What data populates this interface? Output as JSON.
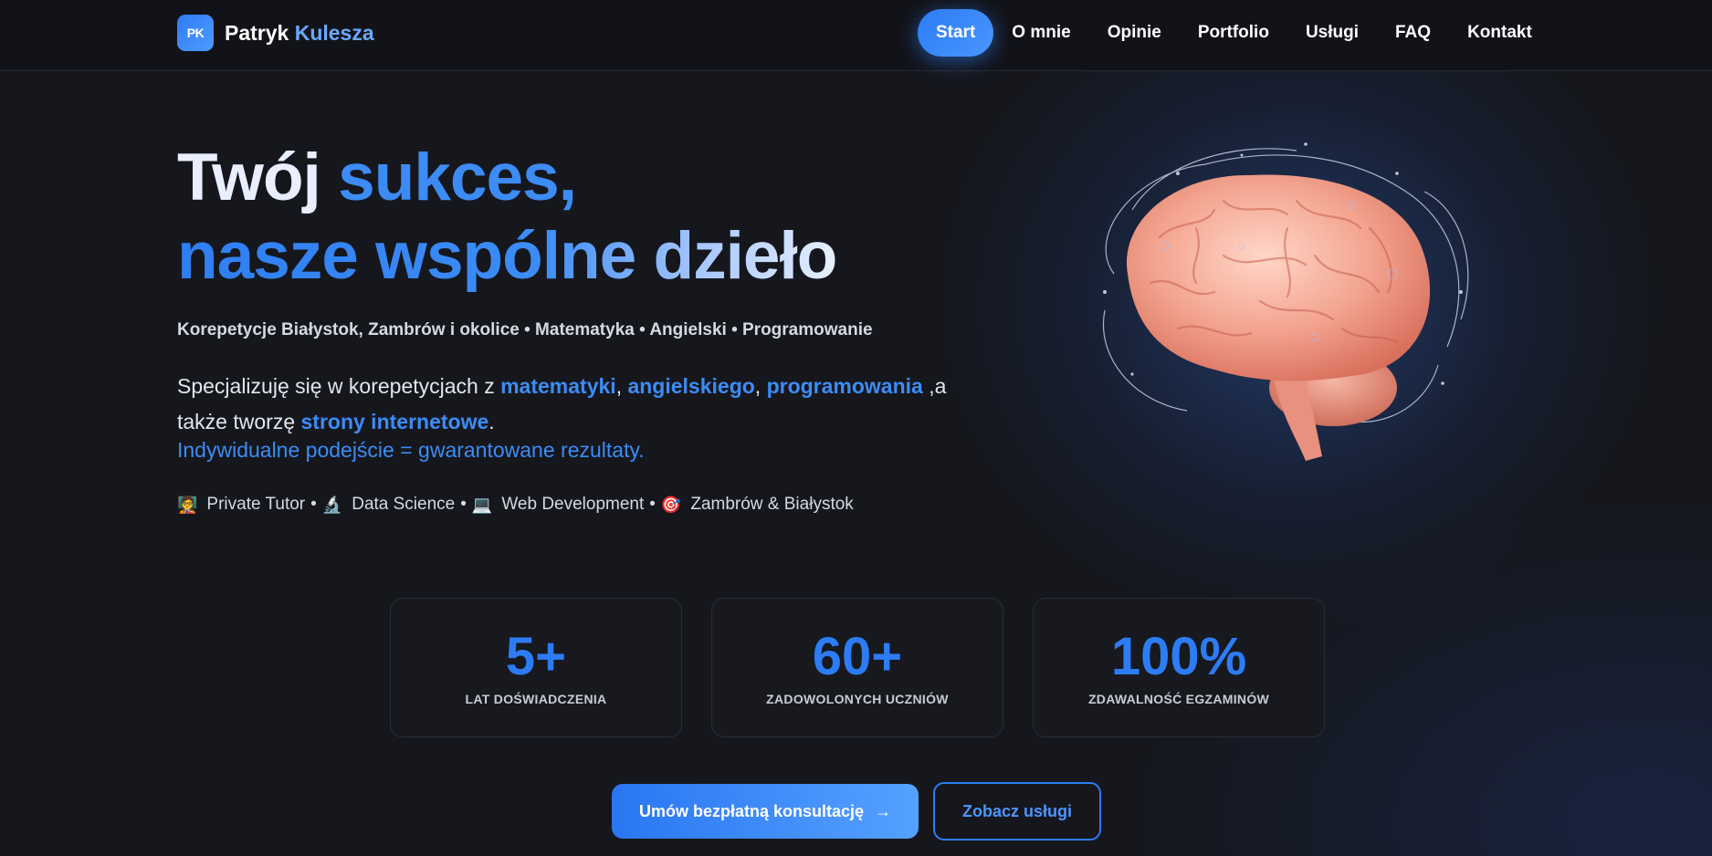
{
  "brand": {
    "badge": "PK",
    "first_name": "Patryk",
    "last_name": "Kulesza"
  },
  "nav": {
    "items": [
      {
        "label": "Start",
        "active": true
      },
      {
        "label": "O mnie"
      },
      {
        "label": "Opinie"
      },
      {
        "label": "Portfolio"
      },
      {
        "label": "Usługi"
      },
      {
        "label": "FAQ"
      },
      {
        "label": "Kontakt"
      }
    ]
  },
  "hero": {
    "title_line1_a": "Twój ",
    "title_line1_b": "sukces,",
    "title_line2": "nasze wspólne dzieło",
    "subtitle": "Korepetycje Białystok, Zambrów i okolice • Matematyka • Angielski • Programowanie",
    "desc": {
      "p1": "Specjalizuję się w korepetycjach z ",
      "h1": "matematyki",
      "p2": ", ",
      "h2": "angielskiego",
      "p3": ", ",
      "h3": "programowania",
      "p4": " ,a",
      "p5": "także tworzę ",
      "h4": "strony internetowe",
      "p6": "."
    },
    "tagline": "Indywidualne podejście = gwarantowane rezultaty.",
    "chips": [
      {
        "icon": "🧑‍🏫",
        "label": "Private Tutor"
      },
      {
        "icon": "🔬",
        "label": "Data Science"
      },
      {
        "icon": "💻",
        "label": "Web Development"
      },
      {
        "icon": "🎯",
        "label": "Zambrów & Białystok"
      }
    ],
    "chip_separator": "•",
    "brain_icon": "brain-illustration"
  },
  "stats": [
    {
      "value": "5+",
      "label": "LAT DOŚWIADCZENIA"
    },
    {
      "value": "60+",
      "label": "ZADOWOLONYCH UCZNIÓW"
    },
    {
      "value": "100%",
      "label": "ZDAWALNOŚĆ EGZAMINÓW"
    }
  ],
  "cta": {
    "primary": "Umów bezpłatną konsultację",
    "primary_arrow": "→",
    "secondary": "Zobacz usługi"
  },
  "colors": {
    "accent": "#2c7cf5",
    "background": "#15171d",
    "nav_bg": "#121318"
  }
}
